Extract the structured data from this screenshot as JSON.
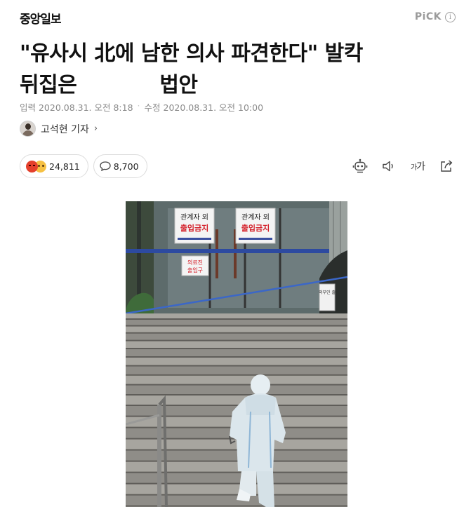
{
  "header": {
    "publisher": "중앙일보",
    "pick_label": "PiCK",
    "info_icon": "info-circle-icon"
  },
  "article": {
    "headline_line1": "\"유사시 北에 남한 의사 파견한다\" 발칵",
    "headline_line2_a": "뒤집은",
    "headline_line2_b": "법안",
    "input_date": "입력 2020.08.31. 오전 8:18",
    "modified_date": "수정 2020.08.31. 오전 10:00",
    "meta_separator": "·",
    "reporter": "고석현 기자",
    "reporter_chevron": "›"
  },
  "reactions": {
    "reaction_count": "24,811",
    "comment_count": "8,700"
  },
  "toolbar": {
    "icons": [
      "robot-summary-icon",
      "speaker-icon",
      "font-size-icon",
      "share-icon"
    ],
    "font_label_small": "가",
    "font_label_big": "가"
  },
  "photo": {
    "sign_left_line1": "관계자 외",
    "sign_left_line2": "출입금지",
    "sign_right_line1": "관계자 외",
    "sign_right_line2": "출입금지",
    "sign_entrance_line1": "의료진",
    "sign_entrance_line2": "출입구",
    "sign_side": "외부인 출"
  }
}
